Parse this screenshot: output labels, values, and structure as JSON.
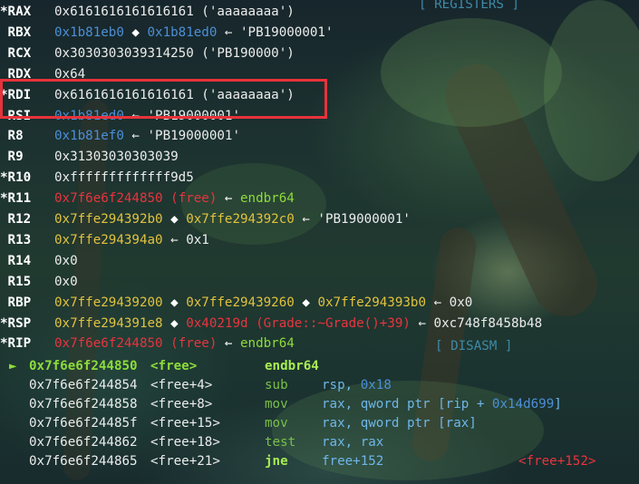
{
  "headers": {
    "registers": "[ REGISTERS ]",
    "disasm": "[ DISASM ]"
  },
  "registers": [
    {
      "marker": "*",
      "name": "RAX",
      "parts": [
        {
          "t": "0x6161616161616161 ('aaaaaaaa')",
          "c": "white"
        }
      ]
    },
    {
      "marker": " ",
      "name": "RBX",
      "parts": [
        {
          "t": "0x1b81eb0",
          "c": "blue"
        },
        {
          "t": " ◆ ",
          "c": "arrow"
        },
        {
          "t": "0x1b81ed0",
          "c": "blue"
        },
        {
          "t": " ← 'PB19000001'",
          "c": "white"
        }
      ]
    },
    {
      "marker": " ",
      "name": "RCX",
      "parts": [
        {
          "t": "0x3030303039314250 ('PB190000')",
          "c": "white"
        }
      ]
    },
    {
      "marker": " ",
      "name": "RDX",
      "parts": [
        {
          "t": "0x64",
          "c": "white"
        }
      ]
    },
    {
      "marker": "*",
      "name": "RDI",
      "parts": [
        {
          "t": "0x6161616161616161 ('aaaaaaaa')",
          "c": "white"
        }
      ]
    },
    {
      "marker": " ",
      "name": "RSI",
      "parts": [
        {
          "t": "0x1b81ed0",
          "c": "blue"
        },
        {
          "t": " ← 'PB19000001'",
          "c": "white"
        }
      ]
    },
    {
      "marker": " ",
      "name": "R8",
      "parts": [
        {
          "t": "0x1b81ef0",
          "c": "blue"
        },
        {
          "t": " ← 'PB19000001'",
          "c": "white"
        }
      ]
    },
    {
      "marker": " ",
      "name": "R9",
      "parts": [
        {
          "t": "0x31303030303039",
          "c": "white"
        }
      ]
    },
    {
      "marker": "*",
      "name": "R10",
      "parts": [
        {
          "t": "0xfffffffffffff9d5",
          "c": "white"
        }
      ]
    },
    {
      "marker": "*",
      "name": "R11",
      "parts": [
        {
          "t": "0x7f6e6f244850 (free)",
          "c": "red"
        },
        {
          "t": " ← ",
          "c": "arrow"
        },
        {
          "t": "endbr64",
          "c": "green"
        }
      ]
    },
    {
      "marker": " ",
      "name": "R12",
      "parts": [
        {
          "t": "0x7ffe294392b0",
          "c": "yellow"
        },
        {
          "t": " ◆ ",
          "c": "arrow"
        },
        {
          "t": "0x7ffe294392c0",
          "c": "yellow"
        },
        {
          "t": " ← 'PB19000001'",
          "c": "white"
        }
      ]
    },
    {
      "marker": " ",
      "name": "R13",
      "parts": [
        {
          "t": "0x7ffe294394a0",
          "c": "yellow"
        },
        {
          "t": " ← 0x1",
          "c": "white"
        }
      ]
    },
    {
      "marker": " ",
      "name": "R14",
      "parts": [
        {
          "t": "0x0",
          "c": "white"
        }
      ]
    },
    {
      "marker": " ",
      "name": "R15",
      "parts": [
        {
          "t": "0x0",
          "c": "white"
        }
      ]
    },
    {
      "marker": " ",
      "name": "RBP",
      "parts": [
        {
          "t": "0x7ffe29439200",
          "c": "yellow"
        },
        {
          "t": " ◆ ",
          "c": "arrow"
        },
        {
          "t": "0x7ffe29439260",
          "c": "yellow"
        },
        {
          "t": " ◆ ",
          "c": "arrow"
        },
        {
          "t": "0x7ffe294393b0",
          "c": "yellow"
        },
        {
          "t": " ← 0x0",
          "c": "white"
        }
      ]
    },
    {
      "marker": "*",
      "name": "RSP",
      "parts": [
        {
          "t": "0x7ffe294391e8",
          "c": "yellow"
        },
        {
          "t": " ◆ ",
          "c": "arrow"
        },
        {
          "t": "0x40219d (Grade::~Grade()+39)",
          "c": "red"
        },
        {
          "t": " ← 0xc748f8458b48",
          "c": "white"
        }
      ]
    },
    {
      "marker": "*",
      "name": "RIP",
      "parts": [
        {
          "t": "0x7f6e6f244850 (free)",
          "c": "red"
        },
        {
          "t": " ← ",
          "c": "arrow"
        },
        {
          "t": "endbr64",
          "c": "green"
        }
      ]
    }
  ],
  "disasm": [
    {
      "current": true,
      "addr": "0x7f6e6f244850",
      "sym": "<free>",
      "mnem": "endbr64",
      "ops": [],
      "extra": ""
    },
    {
      "current": false,
      "addr": "0x7f6e6f244854",
      "sym": "<free+4>",
      "mnem": "sub",
      "ops": [
        {
          "t": "rsp, ",
          "c": "op"
        },
        {
          "t": "0x18",
          "c": "num"
        }
      ],
      "extra": ""
    },
    {
      "current": false,
      "addr": "0x7f6e6f244858",
      "sym": "<free+8>",
      "mnem": "mov",
      "ops": [
        {
          "t": "rax, qword ptr [rip + ",
          "c": "op"
        },
        {
          "t": "0x14d699",
          "c": "num"
        },
        {
          "t": "]",
          "c": "op"
        }
      ],
      "extra": ""
    },
    {
      "current": false,
      "addr": "0x7f6e6f24485f",
      "sym": "<free+15>",
      "mnem": "mov",
      "ops": [
        {
          "t": "rax, qword ptr [rax]",
          "c": "op"
        }
      ],
      "extra": ""
    },
    {
      "current": false,
      "addr": "0x7f6e6f244862",
      "sym": "<free+18>",
      "mnem": "test",
      "ops": [
        {
          "t": "rax, rax",
          "c": "op"
        }
      ],
      "extra": ""
    },
    {
      "current": false,
      "addr": "0x7f6e6f244865",
      "sym": "<free+21>",
      "mnem": "jne",
      "ops": [
        {
          "t": "free+152",
          "c": "op"
        }
      ],
      "extra": "<free+152>"
    }
  ],
  "current_marker": "►"
}
